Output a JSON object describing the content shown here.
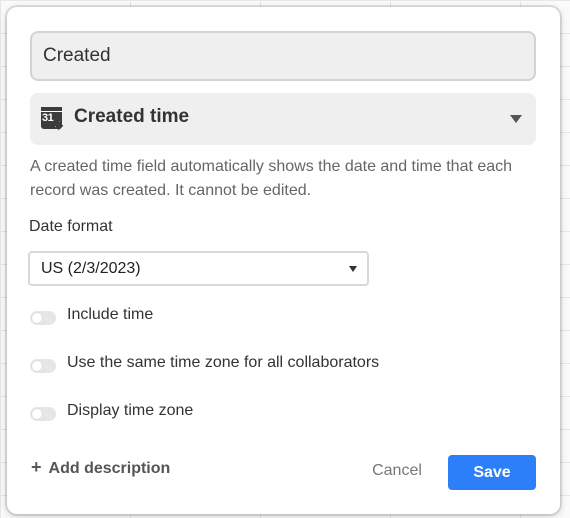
{
  "field": {
    "name_value": "Created"
  },
  "field_type": {
    "icon": "calendar-created-icon",
    "label": "Created time"
  },
  "description": "A created time field automatically shows the date and time that each record was created. It cannot be edited.",
  "date_format": {
    "label": "Date format",
    "selected": "US (2/3/2023)"
  },
  "toggles": [
    {
      "label": "Include time",
      "checked": false
    },
    {
      "label": "Use the same time zone for all collaborators",
      "checked": false
    },
    {
      "label": "Display time zone",
      "checked": false
    }
  ],
  "footer": {
    "add_description_label": "Add description",
    "cancel_label": "Cancel",
    "save_label": "Save"
  },
  "colors": {
    "primary": "#2d7ff9",
    "toggle_off": "#e6e6e6",
    "input_bg": "#efefef"
  }
}
